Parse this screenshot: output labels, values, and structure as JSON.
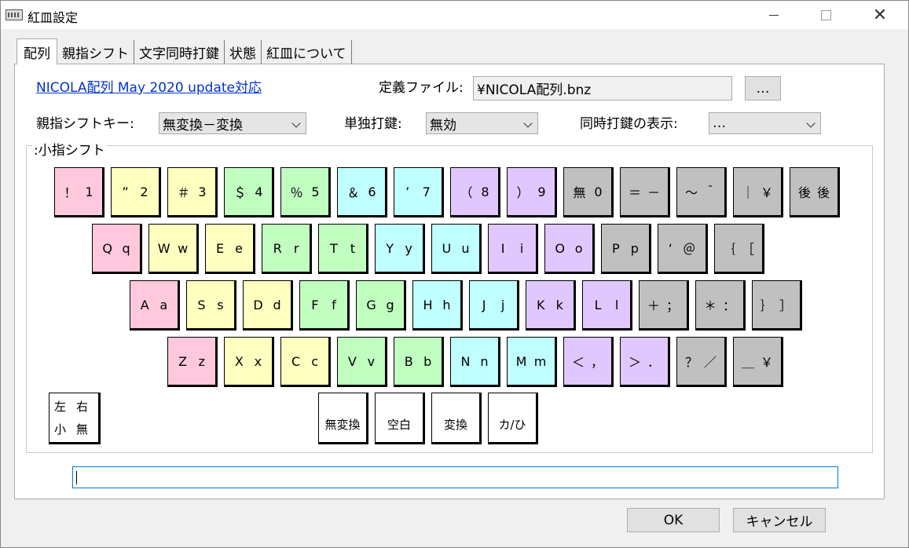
{
  "window": {
    "title": "紅皿設定"
  },
  "tabs": [
    "配列",
    "親指シフト",
    "文字同時打鍵",
    "状態",
    "紅皿について"
  ],
  "header": {
    "link": "NICOLA配列 May 2020 update対応",
    "def_file_label": "定義ファイル:",
    "def_file_value": "¥NICOLA配列.bnz",
    "browse_label": "…",
    "thumb_key_label": "親指シフトキー:",
    "thumb_key_value": "無変換－変換",
    "single_label": "単独打鍵:",
    "single_value": "無効",
    "simul_label": "同時打鍵の表示:",
    "simul_value": "…"
  },
  "group_label": ":小指シフト",
  "rows": [
    [
      [
        "！",
        "1",
        "pink"
      ],
      [
        "”",
        "2",
        "yellow"
      ],
      [
        "＃",
        "3",
        "yellow"
      ],
      [
        "＄",
        "4",
        "green"
      ],
      [
        "％",
        "5",
        "green"
      ],
      [
        "＆",
        "6",
        "cyan"
      ],
      [
        "’",
        "7",
        "cyan"
      ],
      [
        "（",
        "8",
        "purple"
      ],
      [
        "）",
        "9",
        "purple"
      ],
      [
        "無",
        "0",
        "gray"
      ],
      [
        "＝",
        "－",
        "gray"
      ],
      [
        "～",
        "＾",
        "gray"
      ],
      [
        "｜",
        "￥",
        "gray"
      ],
      [
        "後",
        "後",
        "gray"
      ]
    ],
    [
      [
        "Q",
        "q",
        "pink"
      ],
      [
        "W",
        "w",
        "yellow"
      ],
      [
        "E",
        "e",
        "yellow"
      ],
      [
        "R",
        "r",
        "green"
      ],
      [
        "T",
        "t",
        "green"
      ],
      [
        "Y",
        "y",
        "cyan"
      ],
      [
        "U",
        "u",
        "cyan"
      ],
      [
        "I",
        "i",
        "purple"
      ],
      [
        "O",
        "o",
        "purple"
      ],
      [
        "P",
        "p",
        "gray"
      ],
      [
        "‘",
        "＠",
        "gray"
      ],
      [
        "｛",
        "［",
        "gray"
      ]
    ],
    [
      [
        "A",
        "a",
        "pink"
      ],
      [
        "S",
        "s",
        "yellow"
      ],
      [
        "D",
        "d",
        "yellow"
      ],
      [
        "F",
        "f",
        "green"
      ],
      [
        "G",
        "g",
        "green"
      ],
      [
        "H",
        "h",
        "cyan"
      ],
      [
        "J",
        "j",
        "cyan"
      ],
      [
        "K",
        "k",
        "purple"
      ],
      [
        "L",
        "l",
        "purple"
      ],
      [
        "＋",
        "；",
        "gray"
      ],
      [
        "＊",
        "：",
        "gray"
      ],
      [
        "｝",
        "］",
        "gray"
      ]
    ],
    [
      [
        "Z",
        "z",
        "pink"
      ],
      [
        "X",
        "x",
        "yellow"
      ],
      [
        "C",
        "c",
        "yellow"
      ],
      [
        "V",
        "v",
        "green"
      ],
      [
        "B",
        "b",
        "green"
      ],
      [
        "N",
        "n",
        "cyan"
      ],
      [
        "M",
        "m",
        "cyan"
      ],
      [
        "＜",
        "，",
        "purple"
      ],
      [
        "＞",
        "．",
        "purple"
      ],
      [
        "？",
        "／",
        "gray"
      ],
      [
        "＿",
        "￥",
        "gray"
      ]
    ]
  ],
  "legend": {
    "tl": "左",
    "tr": "右",
    "bl": "小",
    "br": "無"
  },
  "thumb_keys": [
    "無変換",
    "空白",
    "変換",
    "カ/ひ"
  ],
  "input_value": "",
  "footer": {
    "ok": "OK",
    "cancel": "キャンセル"
  }
}
